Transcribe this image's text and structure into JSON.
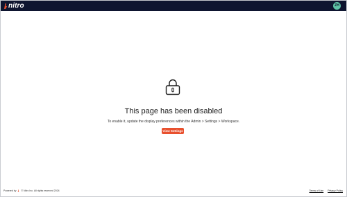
{
  "header": {
    "brand": "nitro",
    "avatar_initials": "ZH"
  },
  "main": {
    "title": "This page has been disabled",
    "message": "To enable it, update the display preferences within the Admin > Settings > Workspace.",
    "button_label": "View Settings"
  },
  "footer": {
    "powered_by": "Powered by",
    "copyright": "© Nitro Inc. All rights reserved 2024",
    "links": [
      "Terms of Use",
      "Privacy Policy"
    ]
  },
  "colors": {
    "topbar": "#0e1530",
    "accent": "#e8502e",
    "avatar": "#5fc4a6"
  }
}
